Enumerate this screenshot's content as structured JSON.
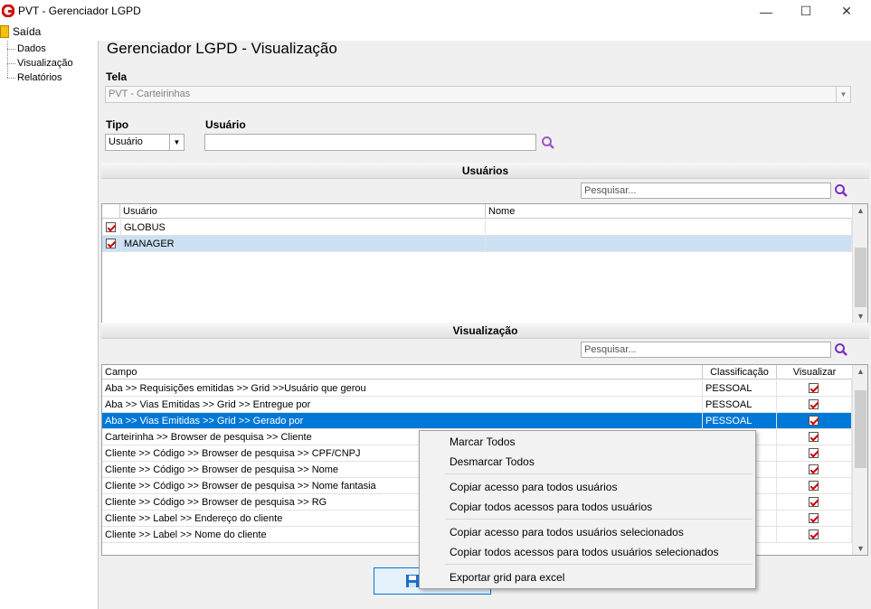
{
  "window": {
    "title": "PVT - Gerenciador LGPD",
    "minimize": "—",
    "maximize": "☐",
    "close": "✕"
  },
  "menu": {
    "exit_label": "Saída"
  },
  "tree": {
    "items": [
      "Dados",
      "Visualização",
      "Relatórios"
    ]
  },
  "page": {
    "title": "Gerenciador LGPD - Visualização"
  },
  "tela": {
    "label": "Tela",
    "value": "PVT - Carteirinhas"
  },
  "tipo": {
    "label": "Tipo",
    "value": "Usuário"
  },
  "usuario": {
    "label": "Usuário",
    "value": ""
  },
  "usuarios_section": {
    "title": "Usuários",
    "search_placeholder": "Pesquisar...",
    "columns": [
      "Usuário",
      "Nome"
    ],
    "rows": [
      {
        "usuario": "GLOBUS",
        "nome": "",
        "checked": true
      },
      {
        "usuario": "MANAGER",
        "nome": "",
        "checked": true
      }
    ]
  },
  "visualizacao_section": {
    "title": "Visualização",
    "search_placeholder": "Pesquisar...",
    "columns": [
      "Campo",
      "Classificação",
      "Visualizar"
    ],
    "rows": [
      {
        "campo": "Aba >> Requisições emitidas  >> Grid >>Usuário que gerou",
        "classificacao": "PESSOAL",
        "visualizar": true
      },
      {
        "campo": "Aba >> Vias Emitidas >> Grid >> Entregue por",
        "classificacao": "PESSOAL",
        "visualizar": true
      },
      {
        "campo": "Aba >> Vias Emitidas >> Grid >> Gerado por",
        "classificacao": "PESSOAL",
        "visualizar": true
      },
      {
        "campo": "Carteirinha >> Browser de pesquisa >> Cliente",
        "classificacao": "",
        "visualizar": true
      },
      {
        "campo": "Cliente >> Código >> Browser de pesquisa >> CPF/CNPJ",
        "classificacao": "",
        "visualizar": true
      },
      {
        "campo": "Cliente >> Código >> Browser de pesquisa >> Nome",
        "classificacao": "",
        "visualizar": true
      },
      {
        "campo": "Cliente >> Código >> Browser de pesquisa >> Nome fantasia",
        "classificacao": "",
        "visualizar": true
      },
      {
        "campo": "Cliente >> Código >> Browser de pesquisa >> RG",
        "classificacao": "",
        "visualizar": true
      },
      {
        "campo": "Cliente >> Label >> Endereço do cliente",
        "classificacao": "",
        "visualizar": true
      },
      {
        "campo": "Cliente >> Label >> Nome do cliente",
        "classificacao": "",
        "visualizar": true
      }
    ]
  },
  "context_menu": {
    "items": [
      "Marcar Todos",
      "Desmarcar Todos",
      "Copiar acesso para todos usuários",
      "Copiar todos acessos para todos usuários",
      "Copiar acesso para todos usuários selecionados",
      "Copiar todos acessos para todos usuários selecionados",
      "Exportar grid para excel"
    ]
  },
  "colors": {
    "accent": "#0078d7",
    "search_icon": "#7b2fbe",
    "check": "#d00000"
  }
}
